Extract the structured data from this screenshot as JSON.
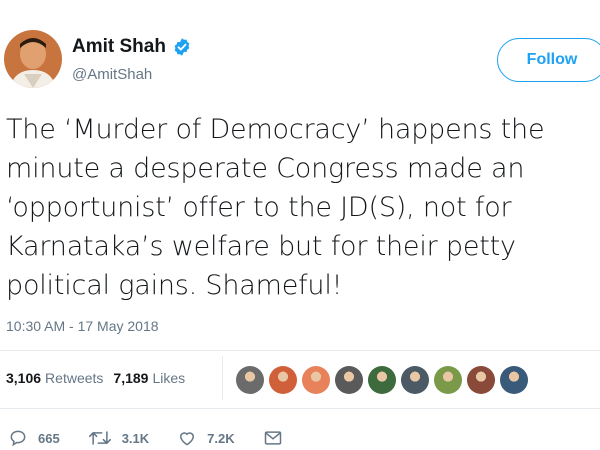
{
  "author": {
    "display_name": "Amit Shah",
    "handle": "@AmitShah",
    "verified": true
  },
  "follow_button": {
    "label": "Follow"
  },
  "tweet": {
    "text": "The ‘Murder of Democracy’ happens the\nminute a desperate Congress made an\n‘opportunist’ offer to the JD(S), not for\nKarnataka’s welfare but for their petty\npolitical gains. Shameful!",
    "timestamp": "10:30 AM - 17 May 2018"
  },
  "stats": {
    "retweets_count": "3,106",
    "retweets_label": "Retweets",
    "likes_count": "7,189",
    "likes_label": "Likes"
  },
  "liked_by_avatars": [
    {
      "icon": "avatar-photo",
      "color": "#6b6b6b"
    },
    {
      "icon": "avatar-photo",
      "color": "#d0603a"
    },
    {
      "icon": "avatar-photo",
      "color": "#e8825a"
    },
    {
      "icon": "avatar-photo",
      "color": "#5a5a5a"
    },
    {
      "icon": "avatar-photo",
      "color": "#3d6b3d"
    },
    {
      "icon": "avatar-photo",
      "color": "#4c5a66"
    },
    {
      "icon": "avatar-photo",
      "color": "#7a9a4a"
    },
    {
      "icon": "avatar-photo",
      "color": "#8a4a3a"
    },
    {
      "icon": "avatar-photo",
      "color": "#3a5a7a"
    }
  ],
  "actions": {
    "reply_count": "665",
    "retweet_count": "3.1K",
    "like_count": "7.2K"
  },
  "colors": {
    "accent": "#1da1f2",
    "text_primary": "#14171a",
    "text_secondary": "#657786",
    "divider": "#e6ecf0"
  }
}
